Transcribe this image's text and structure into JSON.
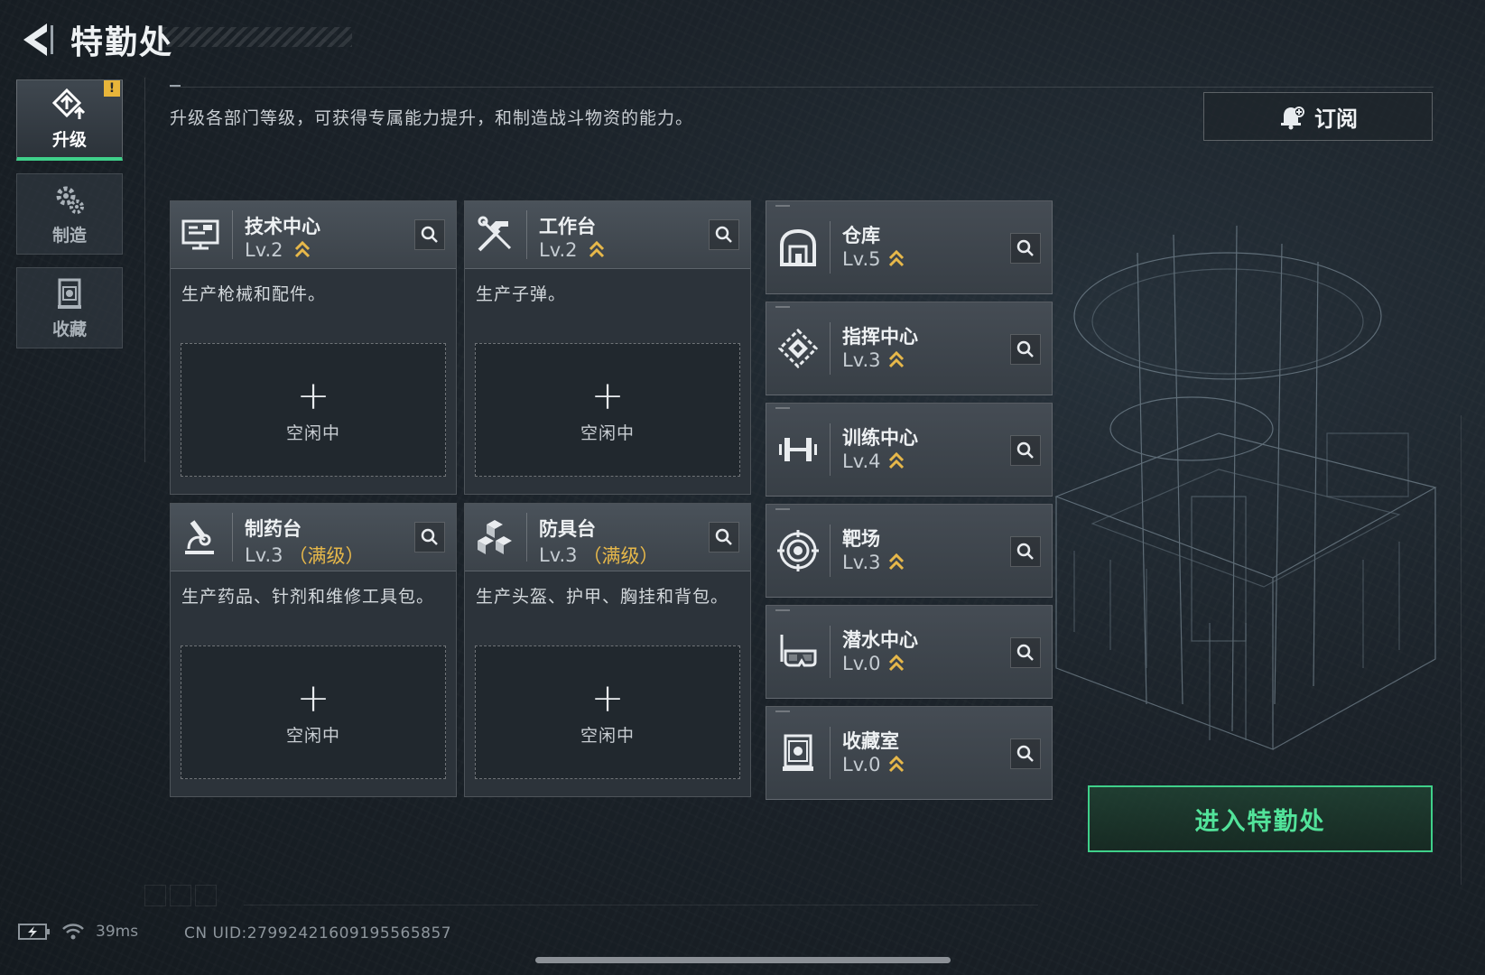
{
  "header": {
    "title": "特勤处"
  },
  "sidebar": {
    "items": [
      {
        "label": "升级",
        "icon": "upgrade-icon",
        "active": true,
        "alert": "!"
      },
      {
        "label": "制造",
        "icon": "gear-icon",
        "active": false
      },
      {
        "label": "收藏",
        "icon": "collection-icon",
        "active": false
      }
    ]
  },
  "main": {
    "description": "升级各部门等级，可获得专属能力提升，和制造战斗物资的能力。",
    "subscribe_label": "订阅",
    "craft_cards": [
      {
        "name": "技术中心",
        "level": "Lv.2",
        "max_tag": "",
        "icon": "computer-icon",
        "desc": "生产枪械和配件。",
        "slot_plus": "+",
        "slot_status": "空闲中"
      },
      {
        "name": "工作台",
        "level": "Lv.2",
        "max_tag": "",
        "icon": "tools-icon",
        "desc": "生产子弹。",
        "slot_plus": "+",
        "slot_status": "空闲中"
      },
      {
        "name": "制药台",
        "level": "Lv.3",
        "max_tag": "（满级）",
        "icon": "microscope-icon",
        "desc": "生产药品、针剂和维修工具包。",
        "slot_plus": "+",
        "slot_status": "空闲中"
      },
      {
        "name": "防具台",
        "level": "Lv.3",
        "max_tag": "（满级）",
        "icon": "armor-blocks-icon",
        "desc": "生产头盔、护甲、胸挂和背包。",
        "slot_plus": "+",
        "slot_status": "空闲中"
      }
    ],
    "facilities": [
      {
        "name": "仓库",
        "level": "Lv.5",
        "icon": "warehouse-icon"
      },
      {
        "name": "指挥中心",
        "level": "Lv.3",
        "icon": "command-center-icon"
      },
      {
        "name": "训练中心",
        "level": "Lv.4",
        "icon": "dumbbell-icon"
      },
      {
        "name": "靶场",
        "level": "Lv.3",
        "icon": "target-icon"
      },
      {
        "name": "潜水中心",
        "level": "Lv.0",
        "icon": "diving-mask-icon"
      },
      {
        "name": "收藏室",
        "level": "Lv.0",
        "icon": "trophy-case-icon"
      }
    ],
    "enter_label": "进入特勤处"
  },
  "status_bar": {
    "ping": "39ms",
    "uid": "CN UID:27992421609195565857"
  },
  "colors": {
    "accent_green": "#3fd08a",
    "max_level_gold": "#e7b84a",
    "alert_yellow": "#e8b53a"
  }
}
